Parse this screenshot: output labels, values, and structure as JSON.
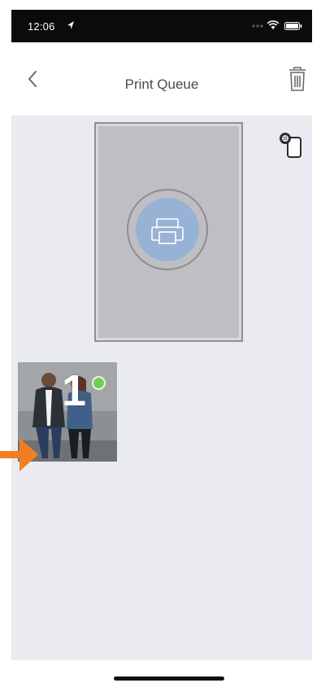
{
  "status_bar": {
    "time": "12:06"
  },
  "nav": {
    "title": "Print Queue",
    "back_icon": "chevron-left-icon",
    "trash_icon": "trash-icon"
  },
  "printer": {
    "icon": "printer-icon",
    "device_icon": "printer-device-icon"
  },
  "queue": {
    "items": [
      {
        "position": "1",
        "status_color": "#6fcf53"
      }
    ]
  },
  "colors": {
    "accent_orange": "#f07f22",
    "printer_blue": "#98b2d6",
    "content_bg": "#e9ebf0"
  }
}
